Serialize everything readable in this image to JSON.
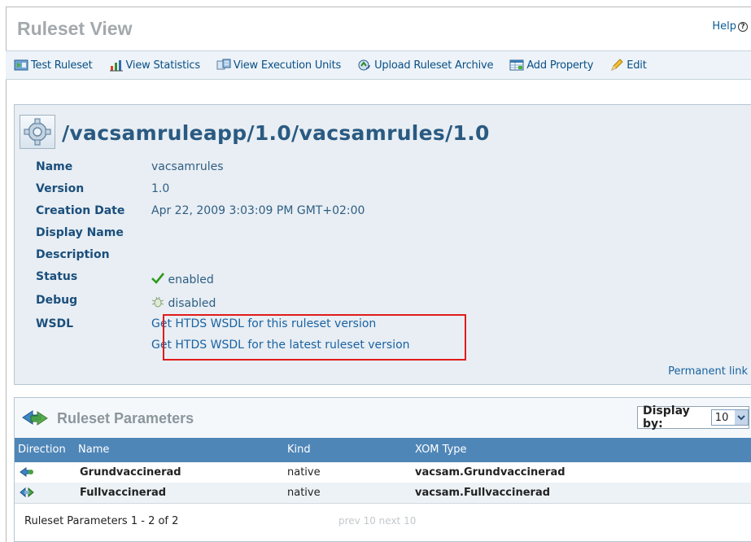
{
  "header": {
    "title": "Ruleset View",
    "help_label": "Help",
    "help_icon": "question-circle-icon"
  },
  "toolbar": {
    "items": [
      {
        "label": "Test Ruleset",
        "icon": "test-ruleset-icon"
      },
      {
        "label": "View Statistics",
        "icon": "statistics-icon"
      },
      {
        "label": "View Execution Units",
        "icon": "execution-units-icon"
      },
      {
        "label": "Upload Ruleset Archive",
        "icon": "upload-icon"
      },
      {
        "label": "Add Property",
        "icon": "add-property-icon"
      },
      {
        "label": "Edit",
        "icon": "pencil-icon"
      }
    ]
  },
  "ruleset": {
    "path": "/vacsamruleapp/1.0/vacsamrules/1.0",
    "labels": {
      "name": "Name",
      "version": "Version",
      "creation_date": "Creation Date",
      "display_name": "Display Name",
      "description": "Description",
      "status": "Status",
      "debug": "Debug",
      "wsdl": "WSDL"
    },
    "name": "vacsamrules",
    "version": "1.0",
    "creation_date": "Apr 22, 2009 3:03:09 PM GMT+02:00",
    "display_name": "",
    "description": "",
    "status": "enabled",
    "debug": "disabled",
    "wsdl_links": [
      "Get HTDS WSDL for this ruleset version",
      "Get HTDS WSDL for the latest ruleset version"
    ],
    "permanent_link": "Permanent link"
  },
  "parameters": {
    "title": "Ruleset Parameters",
    "display_by_label": "Display by:",
    "display_by_value": "10",
    "columns": [
      "Direction",
      "Name",
      "Kind",
      "XOM Type"
    ],
    "rows": [
      {
        "direction": "in",
        "name": "Grundvaccinerad",
        "kind": "native",
        "xom_type": "vacsam.Grundvaccinerad"
      },
      {
        "direction": "inout",
        "name": "Fullvaccinerad",
        "kind": "native",
        "xom_type": "vacsam.Fullvaccinerad"
      }
    ],
    "footer_count": "Ruleset Parameters 1 - 2 of 2",
    "pager": "prev 10 next 10"
  },
  "colors": {
    "title": "#a3a9ad",
    "link": "#1a62a2",
    "label": "#1b4f7c",
    "table_header": "#4f86b8",
    "highlight_box": "#e01b1b",
    "status_ok": "#2e9a1e"
  }
}
